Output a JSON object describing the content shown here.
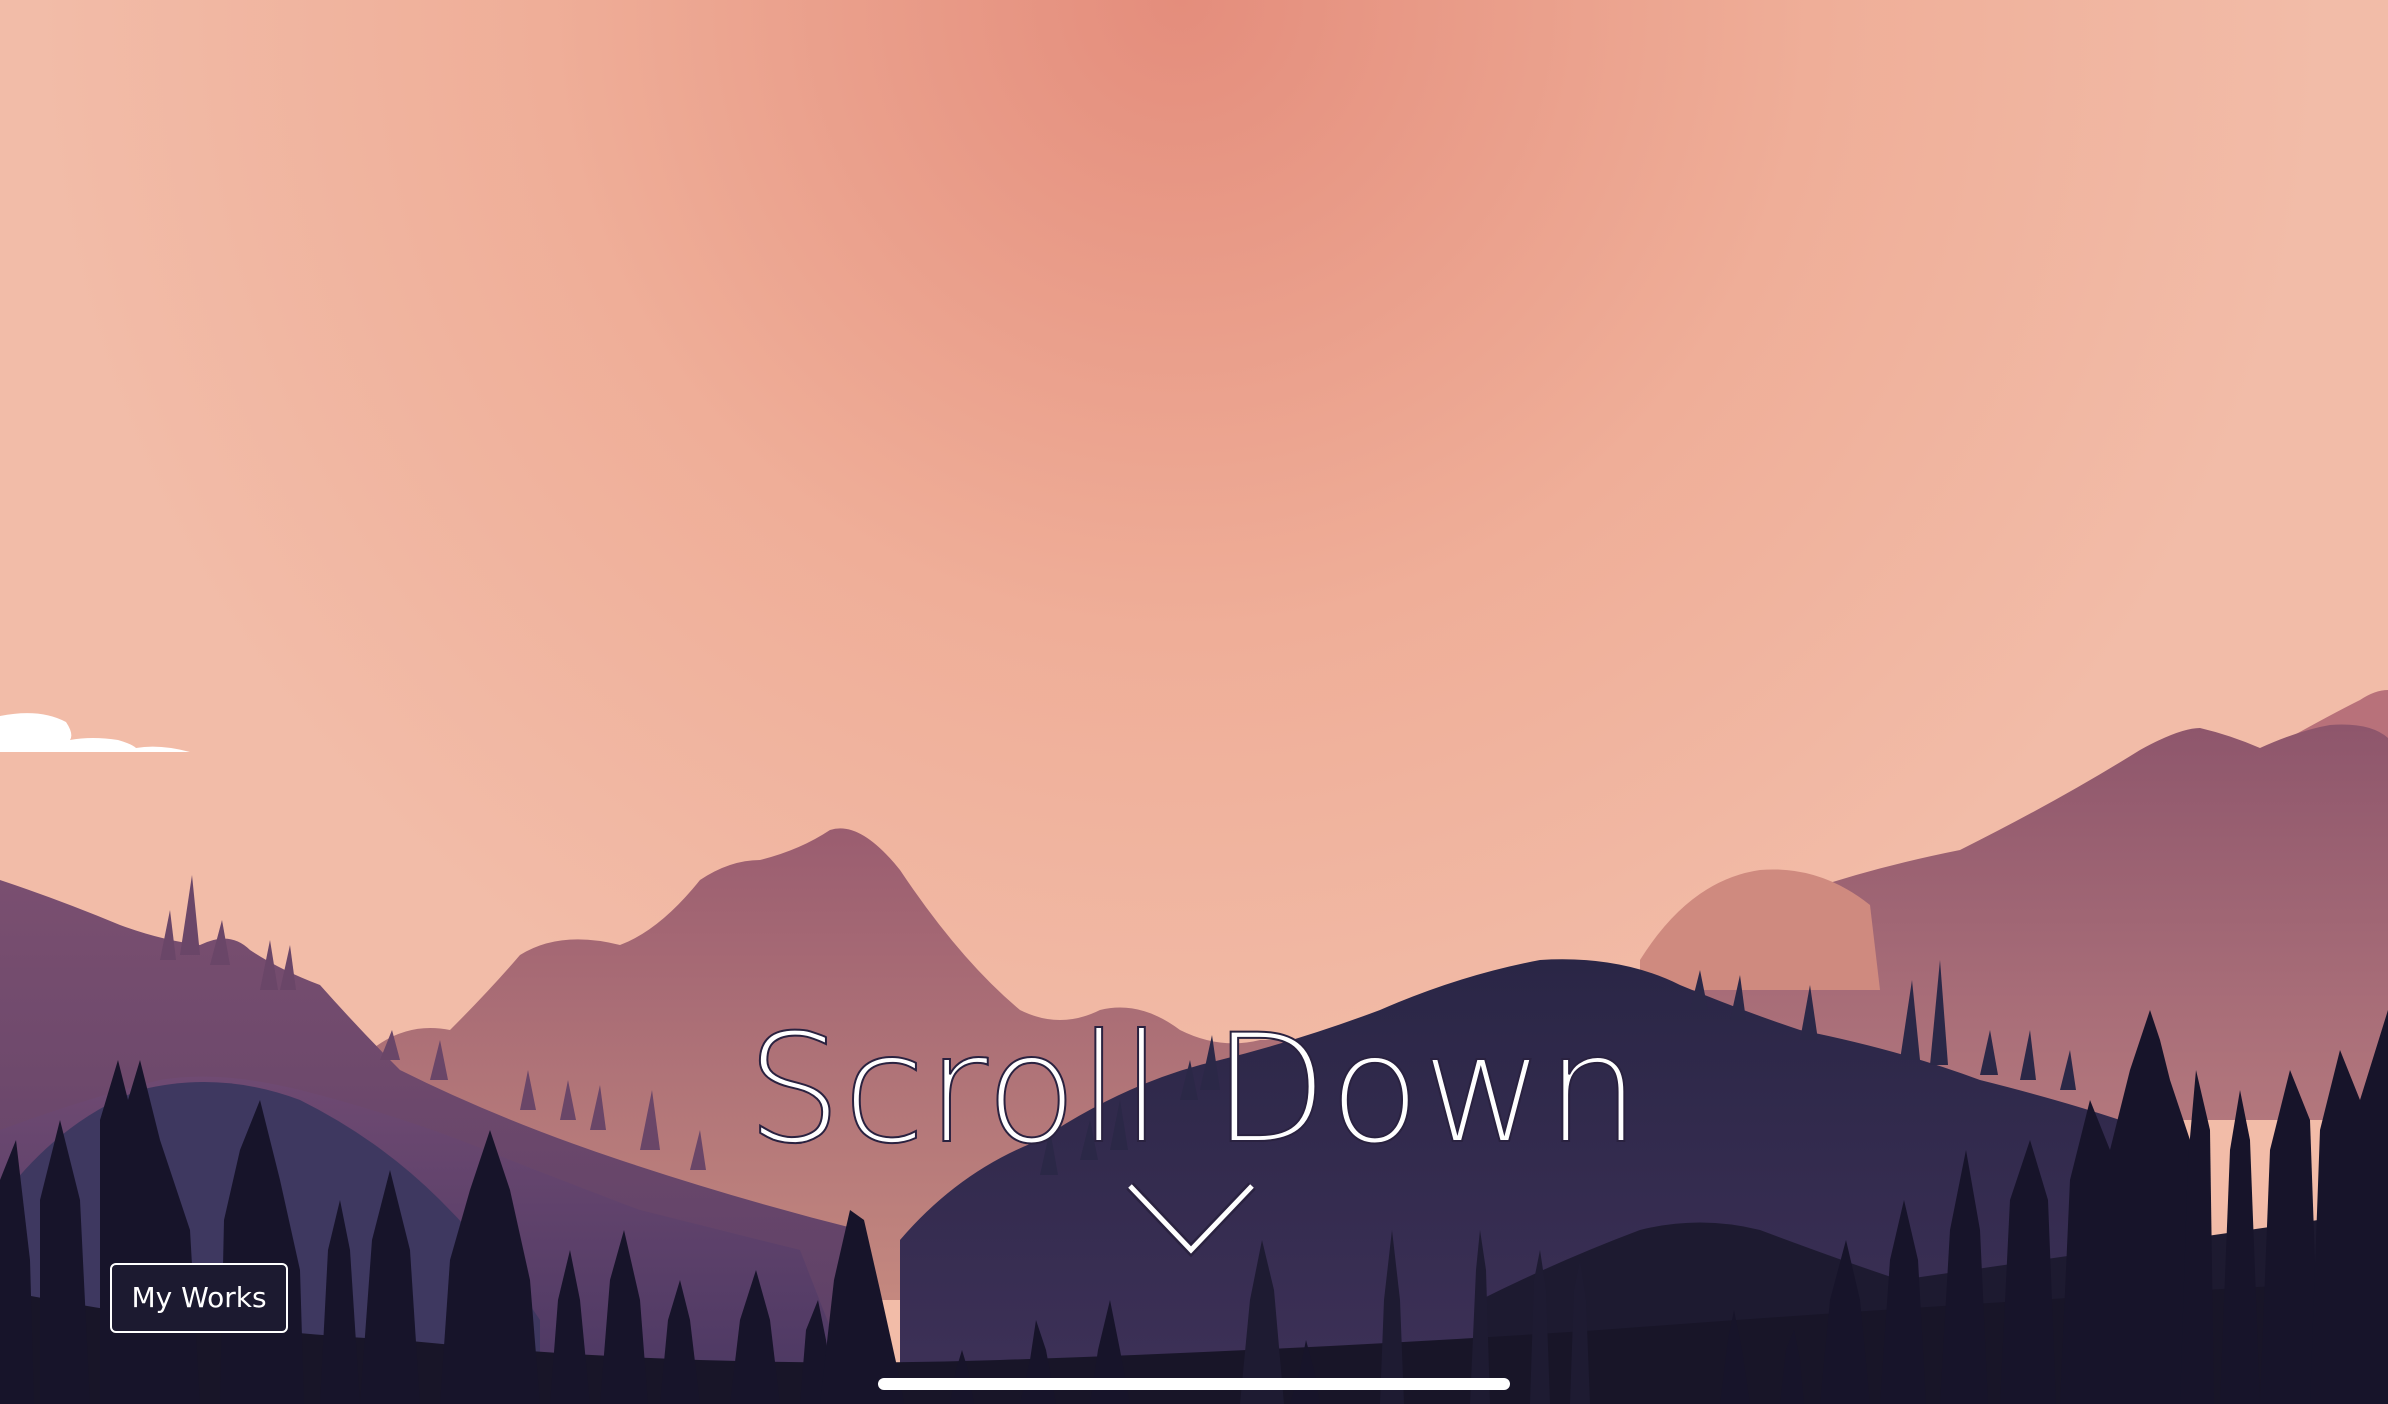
{
  "hero": {
    "title": "Scroll Down"
  },
  "nav": {
    "my_works_label": "My Works"
  },
  "icons": {
    "scroll_cue": "chevron-down-icon"
  },
  "colors": {
    "sky_center": "#e48d7c",
    "sky_edge": "#f2bca8",
    "far_mountain": "#8c5a70",
    "mid_hill": "#2b2847",
    "forest": "#181528",
    "text": "#ffffff"
  }
}
